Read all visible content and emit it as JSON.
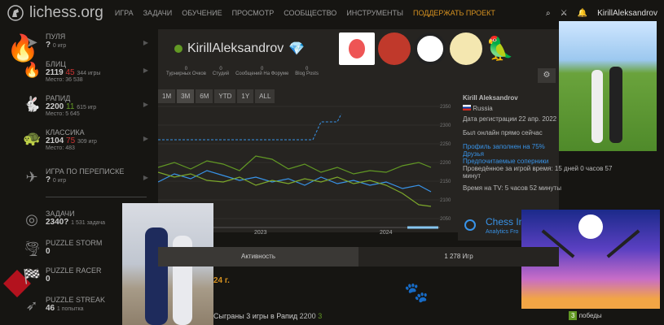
{
  "site": {
    "logo": "lichess.org"
  },
  "nav": {
    "items": [
      "ИГРА",
      "ЗАДАЧИ",
      "ОБУЧЕНИЕ",
      "ПРОСМОТР",
      "СООБЩЕСТВО",
      "ИНСТРУМЕНТЫ"
    ],
    "donate": "ПОДДЕРЖАТЬ ПРОЕКТ"
  },
  "user": {
    "name": "KirillAleksandrov",
    "display": "KirillAleksandrov"
  },
  "perfs": [
    {
      "name": "ПУЛЯ",
      "rating": "?",
      "sub": "0 игр"
    },
    {
      "name": "БЛИЦ",
      "rating": "2119",
      "delta": "45",
      "games": "344 игры",
      "place": "Место: 36 538"
    },
    {
      "name": "РАПИД",
      "rating": "2200",
      "delta": "11",
      "games": "615 игр",
      "place": "Место: 5 645"
    },
    {
      "name": "КЛАССИКА",
      "rating": "2104",
      "delta": "75",
      "games": "309 игр",
      "place": "Место: 483"
    },
    {
      "name": "ИГРА ПО ПЕРЕПИСКЕ",
      "rating": "?",
      "sub": "0 игр"
    },
    {
      "name": "ЗАДАЧИ",
      "rating": "2340?",
      "sub": "1 531 задача"
    },
    {
      "name": "PUZZLE STORM",
      "rating": "0"
    },
    {
      "name": "PUZZLE RACER",
      "rating": "0"
    },
    {
      "name": "PUZZLE STREAK",
      "rating": "46",
      "sub": "1 попытка"
    }
  ],
  "stats": [
    {
      "value": "0",
      "label": "Турнирных Очков"
    },
    {
      "value": "0",
      "label": "Студий"
    },
    {
      "value": "0",
      "label": "Сообщений На Форуме"
    },
    {
      "value": "0",
      "label": "Blog Posts"
    }
  ],
  "range": [
    "1M",
    "3M",
    "6M",
    "YTD",
    "1Y",
    "ALL"
  ],
  "chart_data": {
    "type": "line",
    "x_ticks": [
      "2023",
      "2024"
    ],
    "y_ticks": [
      2050,
      2100,
      2150,
      2200,
      2250,
      2300,
      2350
    ]
  },
  "info": {
    "name": "Kirill Aleksandrov",
    "country": "Russia",
    "registered": "Дата регистрации 22 апр. 2022",
    "online": "Был онлайн прямо сейчас",
    "profile": "Профиль заполнен на 75%",
    "friends": "Друзья",
    "opponents": "Предпочитаемые соперники",
    "playtime": "Проведённое за игрой время: 15 дней 0 часов 57 минут",
    "tv": "Время на TV: 5 часов 52 минуты"
  },
  "chessinfo": {
    "title": "Chess In",
    "sub": "Analytics Fro"
  },
  "tabs": [
    "Активность",
    "1 278 Игр"
  ],
  "activity": {
    "year": "24 г.",
    "text": "Сыграны 3 игры в Рапид",
    "rating": "2200",
    "delta": "3",
    "wins": "3",
    "wins_label": "победы"
  }
}
